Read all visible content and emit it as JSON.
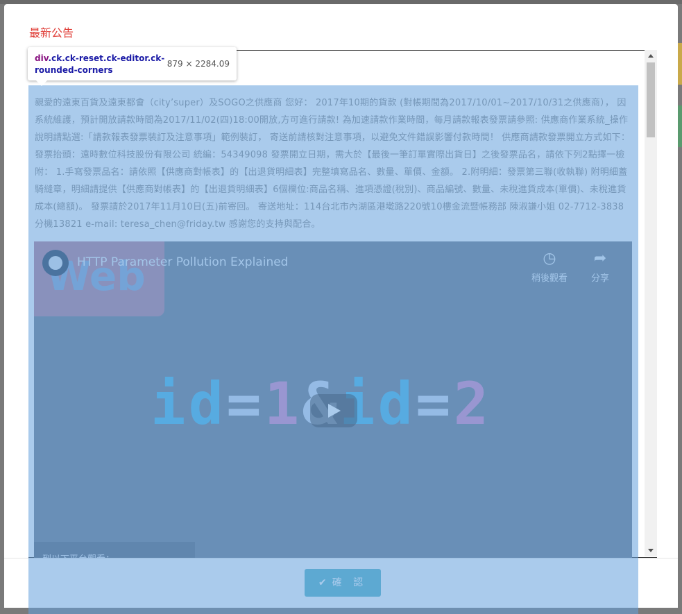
{
  "modal": {
    "title": "最新公告",
    "confirm_label": "確 認",
    "confirm_icon": "check-icon"
  },
  "announcement": {
    "text": "親愛的遠東百貨及遠東都會（city’super）及SOGO之供應商 您好： 2017年10期的貨款 (對帳期間為2017/10/01~2017/10/31之供應商）， 因系統維護，預計開放請款時間為2017/11/02(四)18:00開放,方可進行請款! 為加速請款作業時間，每月請款報表發票請參照: 供應商作業系統_操作說明請點選:「請款報表發票裝訂及注意事項」範例裝訂， 寄送前請核對注意事項，以避免文件錯誤影響付款時間！ 供應商請款發票開立方式如下： 發票抬頭：遠時數位科技股份有限公司 統編：54349098 發票開立日期，需大於【最後一筆訂單實際出貨日】之後發票品名，請依下列2點擇一檢附： 1.手寫發票品名：請依照【供應商對帳表】的【出退貨明細表】完整填寫品名、數量、單價、金額。 2.附明細：發票第三聯(收執聯) 附明細蓋騎縫章，明細請提供【供應商對帳表】的【出退貨明細表】6個欄位:商品名稱、進項憑證(稅別)、商品編號、數量、未稅進貨成本(單價)、未稅進貨成本(總額)。 發票請於2017年11月10日(五)前寄回。 寄送地址：114台北市內湖區港墘路220號10樓金流暨帳務部 陳淑謙小姐 02-7712-3838分機13821 e-mail: teresa_chen@friday.tw 感謝您的支持與配合。"
  },
  "video": {
    "title": "HTTP Parameter Pollution Explained",
    "watch_later_label": "稍後觀看",
    "share_label": "分享",
    "watermark": "Web",
    "formula": {
      "id1": "id",
      "eq1": "=",
      "v1": "1",
      "amp": "&",
      "id2": "id",
      "eq2": "=",
      "v2": "2"
    },
    "platform_text": "到以下平台觀看："
  },
  "devtools_tooltip": {
    "tag": "div",
    "classes": ".ck.ck-reset.ck-editor.ck-rounded-corners",
    "size": "879 × 2284.09"
  }
}
